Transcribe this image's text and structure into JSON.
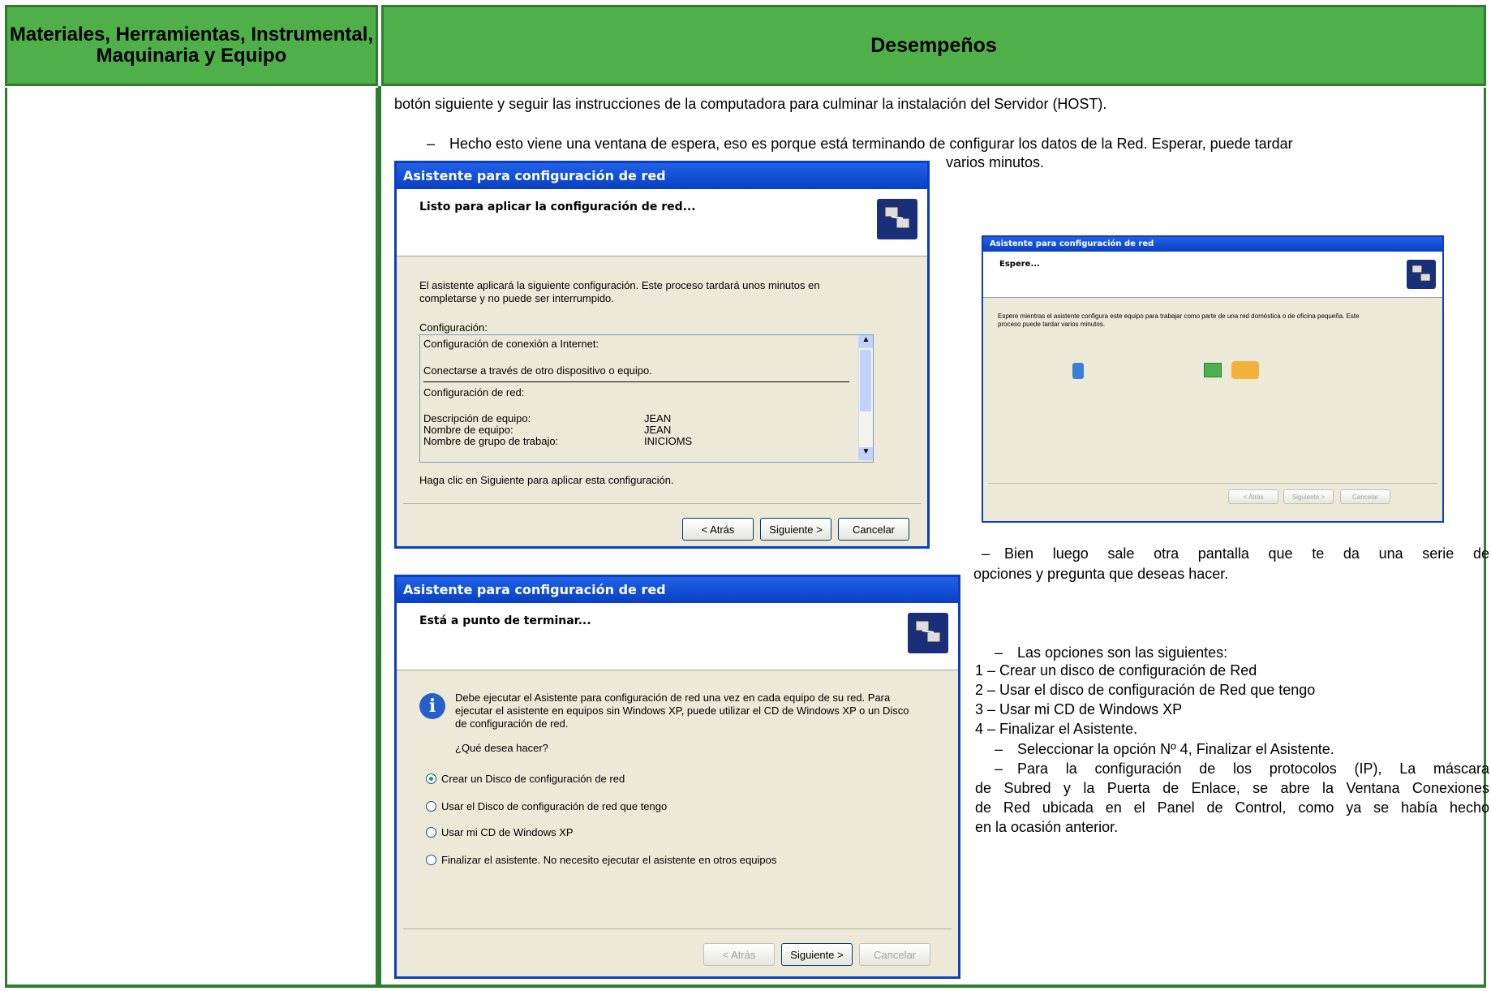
{
  "table": {
    "header_left": "Materiales, Herramientas, Instrumental, Maquinaria y Equipo",
    "header_right": "Desempeños"
  },
  "content": {
    "line1": "botón siguiente y seguir las instrucciones de la computadora para culminar la instalación del Servidor (HOST).",
    "bullet_dash": "–",
    "para1_a": "Hecho esto viene una ventana de espera, eso es porque está terminando de configurar los datos de la Red. Esperar, puede tardar",
    "para1_b": "varios minutos.",
    "para2_a": "Bien luego sale otra pantalla que te da una serie de",
    "para2_b": "opciones y pregunta que deseas hacer.",
    "para3": "Las opciones son las siguientes:",
    "options": [
      "1 – Crear un disco de configuración de Red",
      "2 – Usar el disco de configuración de Red que tengo",
      "3 – Usar mi CD de Windows XP",
      "4 – Finalizar el Asistente."
    ],
    "para4": "Seleccionar la opción Nº 4, Finalizar el Asistente.",
    "para5_a": "Para la configuración de los protocolos (IP), La máscara",
    "para5_b": "de Subred y la Puerta de Enlace, se abre la Ventana Conexiones",
    "para5_c": "de Red ubicada en el Panel de Control, como ya se había hecho",
    "para5_d": "en la ocasión anterior."
  },
  "dialog1": {
    "title": "Asistente para configuración de red",
    "heading": "Listo para aplicar la configuración de red...",
    "intro": "El asistente aplicará la siguiente configuración. Este proceso tardará unos minutos en completarse y no puede ser interrumpido.",
    "config_label": "Configuración:",
    "list": {
      "l1": "Configuración de conexión a Internet:",
      "l2": "Conectarse a través de otro dispositivo o equipo.",
      "l3": "Configuración de red:",
      "k1": "Descripción de equipo:",
      "v1": "JEAN",
      "k2": "Nombre de equipo:",
      "v2": "JEAN",
      "k3": "Nombre de grupo de trabajo:",
      "v3": "INICIOMS"
    },
    "footer_text": "Haga clic en Siguiente para aplicar esta configuración.",
    "btn_back": "< Atrás",
    "btn_next": "Siguiente >",
    "btn_cancel": "Cancelar"
  },
  "dialog2": {
    "title": "Asistente para configuración de red",
    "heading": "Espere...",
    "intro": "Espere mientras el asistente configura este equipo para trabajar como parte de una red doméstica o de oficina pequeña. Este proceso puede tardar varios minutos.",
    "btn_back": "< Atrás",
    "btn_next": "Siguiente >",
    "btn_cancel": "Cancelar"
  },
  "dialog3": {
    "title": "Asistente para configuración de red",
    "heading": "Está a punto de terminar...",
    "info": "Debe ejecutar el Asistente para configuración de red una vez en cada equipo de su red. Para ejecutar el asistente en equipos sin Windows XP, puede utilizar el CD de Windows XP o un Disco de configuración de red.",
    "question": "¿Qué desea hacer?",
    "radios": [
      "Crear un Disco de configuración de red",
      "Usar el Disco de configuración de red que tengo",
      "Usar mi CD de Windows XP",
      "Finalizar el asistente. No necesito ejecutar el asistente en otros equipos"
    ],
    "selected_index": 0,
    "btn_back": "< Atrás",
    "btn_next": "Siguiente >",
    "btn_cancel": "Cancelar"
  }
}
